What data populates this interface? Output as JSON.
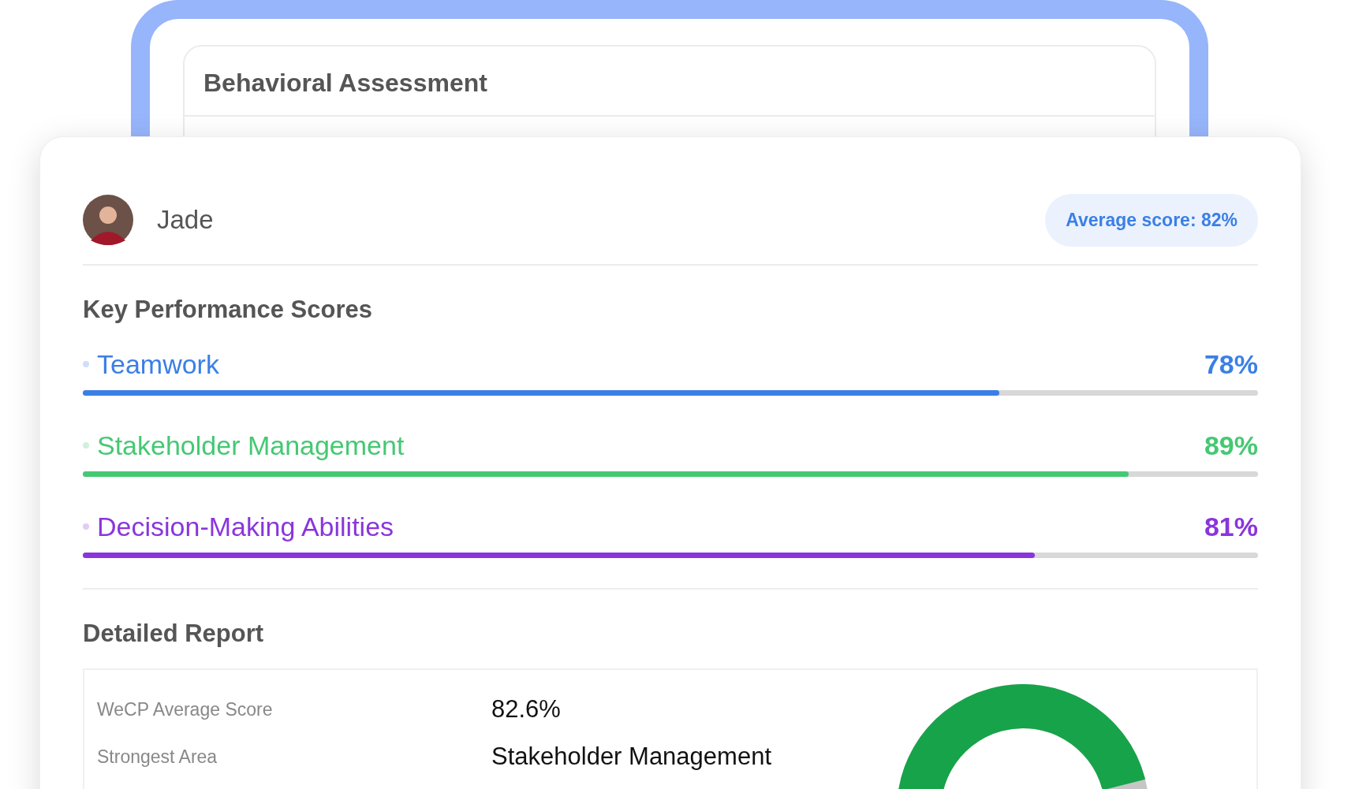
{
  "back_card": {
    "title": "Behavioral Assessment"
  },
  "candidate": {
    "name": "Jade",
    "average": "Average score: 82%"
  },
  "key_scores": {
    "title": "Key Performance Scores",
    "items": [
      {
        "label": "Teamwork",
        "value": "78%",
        "level": 0.78,
        "color": "#3b7fe6"
      },
      {
        "label": "Stakeholder Management",
        "value": "89%",
        "level": 0.89,
        "color": "#45c873"
      },
      {
        "label": "Decision-Making Abilities",
        "value": "81%",
        "level": 0.81,
        "color": "#8a35dc"
      }
    ]
  },
  "report": {
    "title": "Detailed Report",
    "rows": [
      {
        "label": "WeCP Average Score",
        "value": "82.6%"
      },
      {
        "label": "Strongest Area",
        "value": "Stakeholder Management"
      }
    ]
  }
}
